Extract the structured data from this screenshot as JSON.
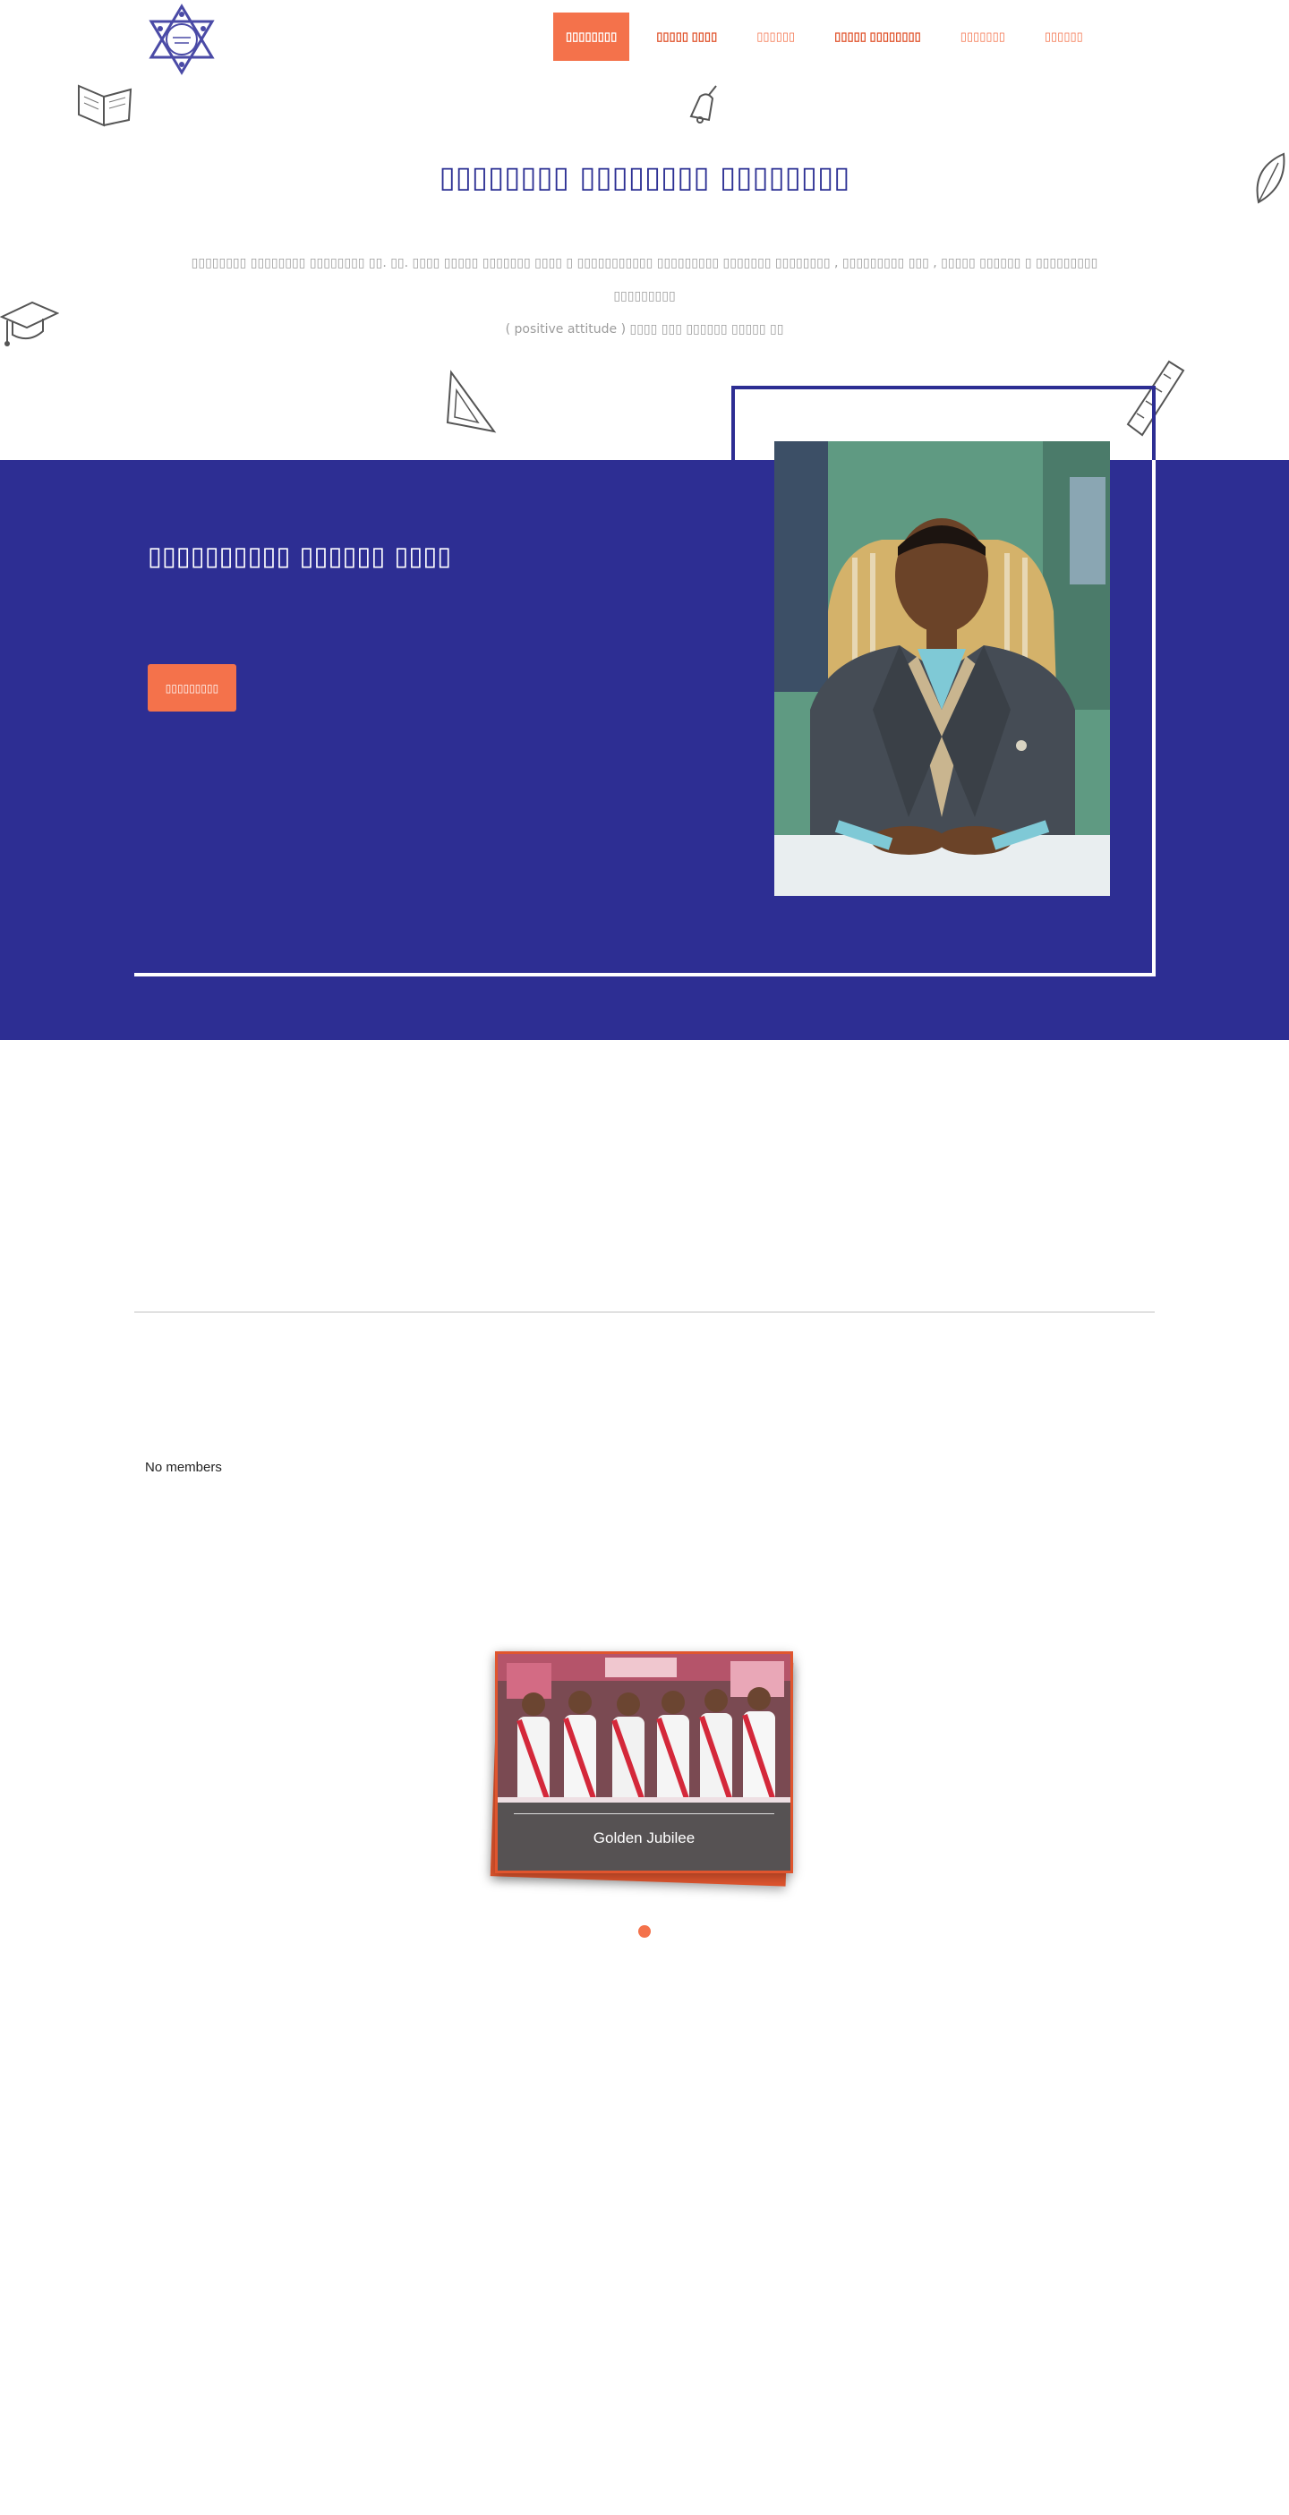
{
  "header": {
    "logo_icon": "college-star-logo-icon",
    "nav": [
      {
        "label": "▯▯▯▯▯▯▯▯",
        "style": "active"
      },
      {
        "label": "▯▯▯▯▯ ▯▯▯▯",
        "style": "bold"
      },
      {
        "label": "▯▯▯▯▯▯",
        "style": "normal"
      },
      {
        "label": "▯▯▯▯▯ ▯▯▯▯▯▯▯▯",
        "style": "bold"
      },
      {
        "label": "▯▯▯▯▯▯▯",
        "style": "normal"
      },
      {
        "label": "▯▯▯▯▯▯",
        "style": "normal"
      }
    ]
  },
  "intro": {
    "title": "▯▯▯▯▯▯▯▯ ▯▯▯▯▯▯▯▯ ▯▯▯▯▯▯▯▯",
    "text_line1": "▯▯▯▯▯▯▯▯ ▯▯▯▯▯▯▯▯ ▯▯▯▯▯▯▯▯ ▯▯. ▯▯. ▯▯▯▯ ▯▯▯▯▯ ▯▯▯▯▯▯▯ ▯▯▯▯ ▯ ▯▯▯▯▯▯▯▯▯▯▯ ▯▯▯▯▯▯▯▯▯ ▯▯▯▯▯▯▯ ▯▯▯▯▯▯▯▯ , ▯▯▯▯▯▯▯▯▯ ▯▯▯ , ▯▯▯▯▯ ▯▯▯▯▯▯ ▯ ▯▯▯▯▯▯▯▯▯ ▯▯▯▯▯▯▯▯▯",
    "text_line2": "( positive attitude ) ▯▯▯▯ ▯▯▯ ▯▯▯▯▯▯ ▯▯▯▯▯ ▯▯"
  },
  "principal": {
    "title": "▯▯▯▯▯▯▯▯▯▯ ▯▯▯▯▯▯ ▯▯▯▯",
    "button_label": "▯▯▯▯▯▯▯▯▯"
  },
  "members": {
    "empty_text": "No members"
  },
  "gallery": {
    "caption": "Golden Jubilee"
  },
  "colors": {
    "accent": "#f4724b",
    "brand_blue": "#2d2e93"
  }
}
